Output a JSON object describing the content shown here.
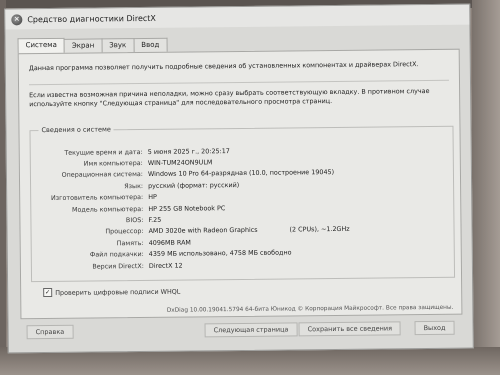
{
  "window": {
    "title": "Средство диагностики DirectX",
    "icon": "directx-icon"
  },
  "tabs": [
    {
      "label": "Система"
    },
    {
      "label": "Экран"
    },
    {
      "label": "Звук"
    },
    {
      "label": "Ввод"
    }
  ],
  "intro": {
    "line1": "Данная программа позволяет получить подробные сведения об установленных компонентах и драйверах DirectX.",
    "line2": "Если известна возможная причина неполадки, можно сразу выбрать соответствующую вкладку. В противном случае используйте кнопку \"Следующая страница\" для последовательного просмотра страниц."
  },
  "system_info": {
    "legend": "Сведения о системе",
    "rows": [
      {
        "label": "Текущие время и дата:",
        "value": "5 июня 2025 г., 20:25:17"
      },
      {
        "label": "Имя компьютера:",
        "value": "WIN-TUM24ON9ULM"
      },
      {
        "label": "Операционная система:",
        "value": "Windows 10 Pro 64-разрядная (10.0, построение 19045)"
      },
      {
        "label": "Язык:",
        "value": "русский (формат: русский)"
      },
      {
        "label": "Изготовитель компьютера:",
        "value": "HP"
      },
      {
        "label": "Модель компьютера:",
        "value": "HP 255 G8 Notebook PC"
      },
      {
        "label": "BIOS:",
        "value": "F.25"
      },
      {
        "label": "Процессор:",
        "value": "AMD 3020e with Radeon Graphics",
        "extra": "(2 CPUs), ~1.2GHz"
      },
      {
        "label": "Память:",
        "value": "4096MB RAM"
      },
      {
        "label": "Файл подкачки:",
        "value": "4359 МБ использовано, 4758 МБ свободно"
      },
      {
        "label": "Версия DirectX:",
        "value": "DirectX 12"
      }
    ]
  },
  "checkbox": {
    "label": "Проверить цифровые подписи WHQL",
    "checked": true
  },
  "footer_note": "DxDiag 10.00.19041.5794 64-бита Юникод  © Корпорация Майкрософт. Все права защищены.",
  "buttons": {
    "help": "Справка",
    "next": "Следующая страница",
    "save": "Сохранить все сведения",
    "exit": "Выход"
  }
}
